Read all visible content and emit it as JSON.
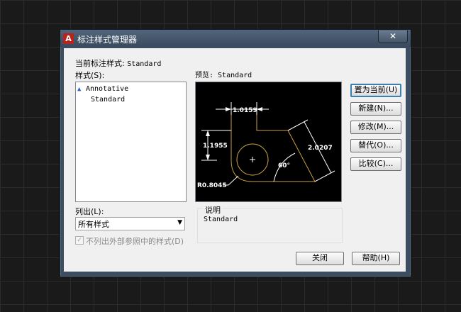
{
  "window": {
    "title": "标注样式管理器",
    "app_icon": "A",
    "close_glyph": "✕"
  },
  "current_style": {
    "label": "当前标注样式:",
    "value": "Standard"
  },
  "styles_list": {
    "label": "样式(S):",
    "items": [
      {
        "name": "Annotative",
        "icon": "annotative-icon",
        "icon_glyph": "▲"
      },
      {
        "name": "Standard"
      }
    ]
  },
  "preview": {
    "label": "预览: Standard",
    "dimensions": {
      "top": "1.0159",
      "left": "1.1955",
      "right": "2.0207",
      "angle": "60°",
      "radius": "R0.8045"
    }
  },
  "buttons": {
    "set_current": "置为当前(U)",
    "new": "新建(N)...",
    "modify": "修改(M)...",
    "override": "替代(O)...",
    "compare": "比较(C)..."
  },
  "list_filter": {
    "label": "列出(L):",
    "selected": "所有样式",
    "arrow_glyph": "▼"
  },
  "xref_checkbox": {
    "label": "不列出外部参照中的样式(D)",
    "checked": true,
    "check_glyph": "✓"
  },
  "description": {
    "label": "说明",
    "text": "Standard"
  },
  "footer": {
    "close": "关闭",
    "help": "帮助(H)"
  },
  "colors": {
    "geometry": "#c8a040",
    "dimension": "#ffffff",
    "preview_bg": "#000000",
    "focus_border": "#3c7fb1"
  }
}
